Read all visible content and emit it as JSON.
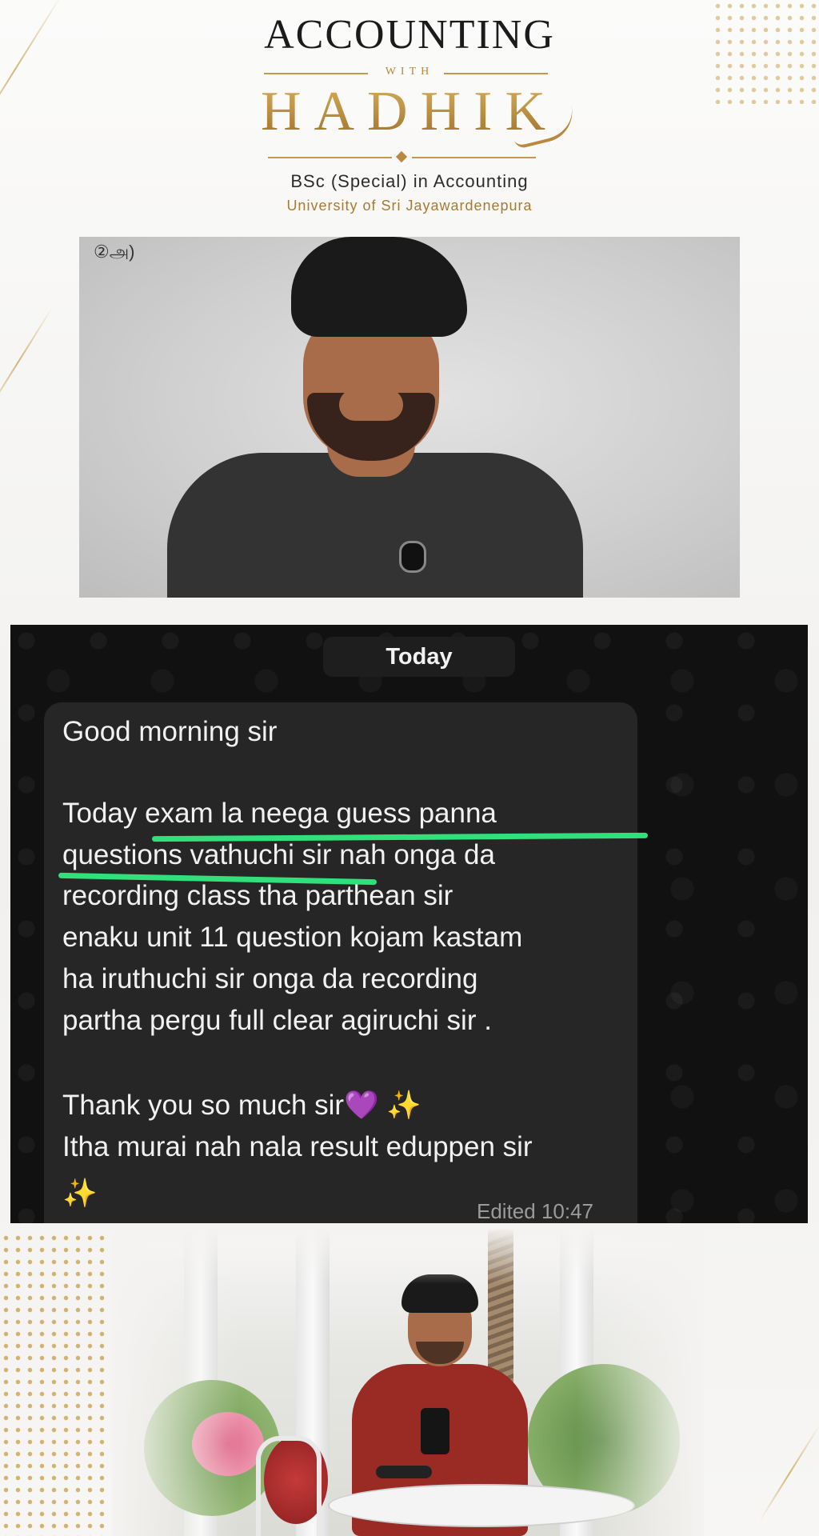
{
  "brand": {
    "line1": "ACCOUNTING",
    "with": "WITH",
    "line2": "HADHIK",
    "degree": "BSc (Special) in Accounting",
    "university": "University of Sri Jayawardenepura",
    "accent": "#B8893F"
  },
  "video": {
    "corner_mark": "②அ)"
  },
  "chat": {
    "date_chip": "Today",
    "lines": [
      "Good morning sir",
      "Today exam la neega guess  panna",
      "questions vathuchi sir nah onga da",
      "recording class tha parthean sir",
      " enaku unit 11 question kojam kastam",
      "ha iruthuchi sir onga da recording",
      "partha pergu full clear agiruchi sir .",
      "Thank you so much sir",
      "Itha murai nah nala result eduppen sir"
    ],
    "emoji_heart": "💜",
    "emoji_sparkles": "✨",
    "timestamp": "Edited 10:47",
    "highlight_color": "#31E07A"
  }
}
